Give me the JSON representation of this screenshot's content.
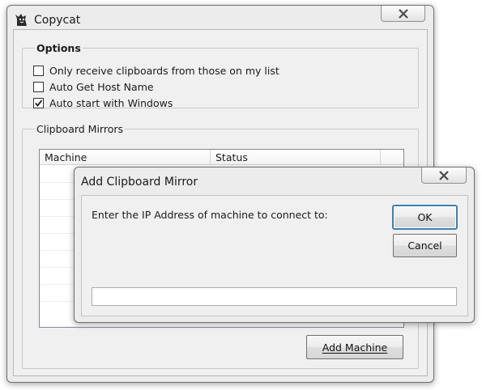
{
  "main_window": {
    "title": "Copycat",
    "options": {
      "legend": "Options",
      "checkboxes": [
        {
          "label": "Only receive clipboards from those on my list",
          "checked": false
        },
        {
          "label": "Auto Get Host Name",
          "checked": false
        },
        {
          "label": "Auto start with Windows",
          "checked": true
        }
      ]
    },
    "mirrors": {
      "legend": "Clipboard Mirrors",
      "columns": [
        "Machine",
        "Status"
      ],
      "add_button": "Add Machine"
    }
  },
  "dialog": {
    "title": "Add Clipboard Mirror",
    "prompt": "Enter the IP Address of machine to connect to:",
    "ok_label": "OK",
    "cancel_label": "Cancel",
    "ip_value": ""
  },
  "icons": {
    "app": "copycat-app-icon",
    "close": "close-icon",
    "check": "checkmark-icon"
  }
}
